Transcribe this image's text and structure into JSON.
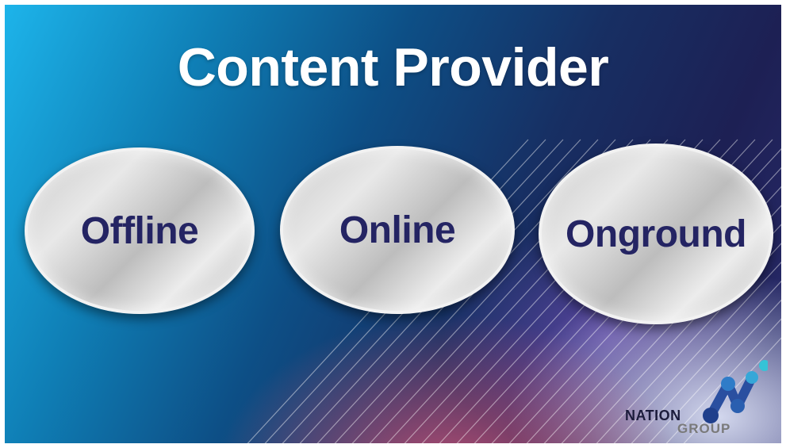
{
  "slide": {
    "title": "Content Provider",
    "items": [
      {
        "label": "Offline"
      },
      {
        "label": "Online"
      },
      {
        "label": "Onground"
      }
    ]
  },
  "logo": {
    "line1": "NATION",
    "line2": "GROUP",
    "mark_icon": "nation-group-n-mark-icon"
  },
  "colors": {
    "title_text": "#ffffff",
    "oval_text": "#242463",
    "background_left": "#1db4ea",
    "background_right": "#1d2054",
    "accent_pink": "#f05a78"
  }
}
